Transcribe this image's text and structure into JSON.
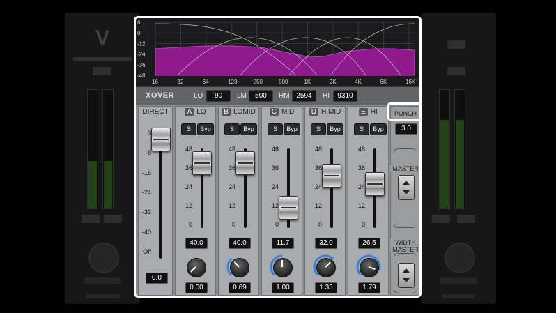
{
  "graph": {
    "db_labels": [
      "6",
      "0",
      "-12",
      "-24",
      "-36",
      "-48"
    ],
    "freq_labels": [
      "16",
      "32",
      "64",
      "128",
      "250",
      "500",
      "1K",
      "2K",
      "4K",
      "8K",
      "16K"
    ]
  },
  "xover": {
    "title": "XOVER",
    "lo_label": "LO",
    "lo_value": "90",
    "lm_label": "LM",
    "lm_value": "500",
    "hm_label": "HM",
    "hm_value": "2594",
    "hi_label": "HI",
    "hi_value": "9310"
  },
  "direct": {
    "label": "DIRECT",
    "ticks": [
      "0",
      "-8",
      "-16",
      "-24",
      "-32",
      "-40",
      "Off"
    ],
    "value": "0.0"
  },
  "bands": [
    {
      "letter": "A",
      "name": "LO",
      "solo": "S",
      "bypass": "Byp",
      "ticks": [
        "48",
        "36",
        "24",
        "12",
        "0"
      ],
      "fader": "40.0",
      "knob": "0.00",
      "knob_fraction": 0.0
    },
    {
      "letter": "B",
      "name": "LOMID",
      "solo": "S",
      "bypass": "Byp",
      "ticks": [
        "48",
        "36",
        "24",
        "12",
        "0"
      ],
      "fader": "40.0",
      "knob": "0.69",
      "knob_fraction": 0.35
    },
    {
      "letter": "C",
      "name": "MID",
      "solo": "S",
      "bypass": "Byp",
      "ticks": [
        "48",
        "36",
        "24",
        "12",
        "0"
      ],
      "fader": "11.7",
      "knob": "1.00",
      "knob_fraction": 0.5
    },
    {
      "letter": "D",
      "name": "HIMID",
      "solo": "S",
      "bypass": "Byp",
      "ticks": [
        "48",
        "36",
        "24",
        "12",
        "0"
      ],
      "fader": "32.0",
      "knob": "1.33",
      "knob_fraction": 0.67
    },
    {
      "letter": "E",
      "name": "HI",
      "solo": "S",
      "bypass": "Byp",
      "ticks": [
        "48",
        "36",
        "24",
        "12",
        "0"
      ],
      "fader": "26.5",
      "knob": "1.79",
      "knob_fraction": 0.9
    }
  ],
  "punch": {
    "label": "PUNCH",
    "value": "3.0"
  },
  "master": {
    "label": "MASTER"
  },
  "width_master": {
    "label": "WIDTH\nMASTER"
  },
  "colors": {
    "spectrum": "#8e1a8e",
    "knob_ring": "#3b7fd6",
    "meter_green": "#3c7a2b"
  }
}
